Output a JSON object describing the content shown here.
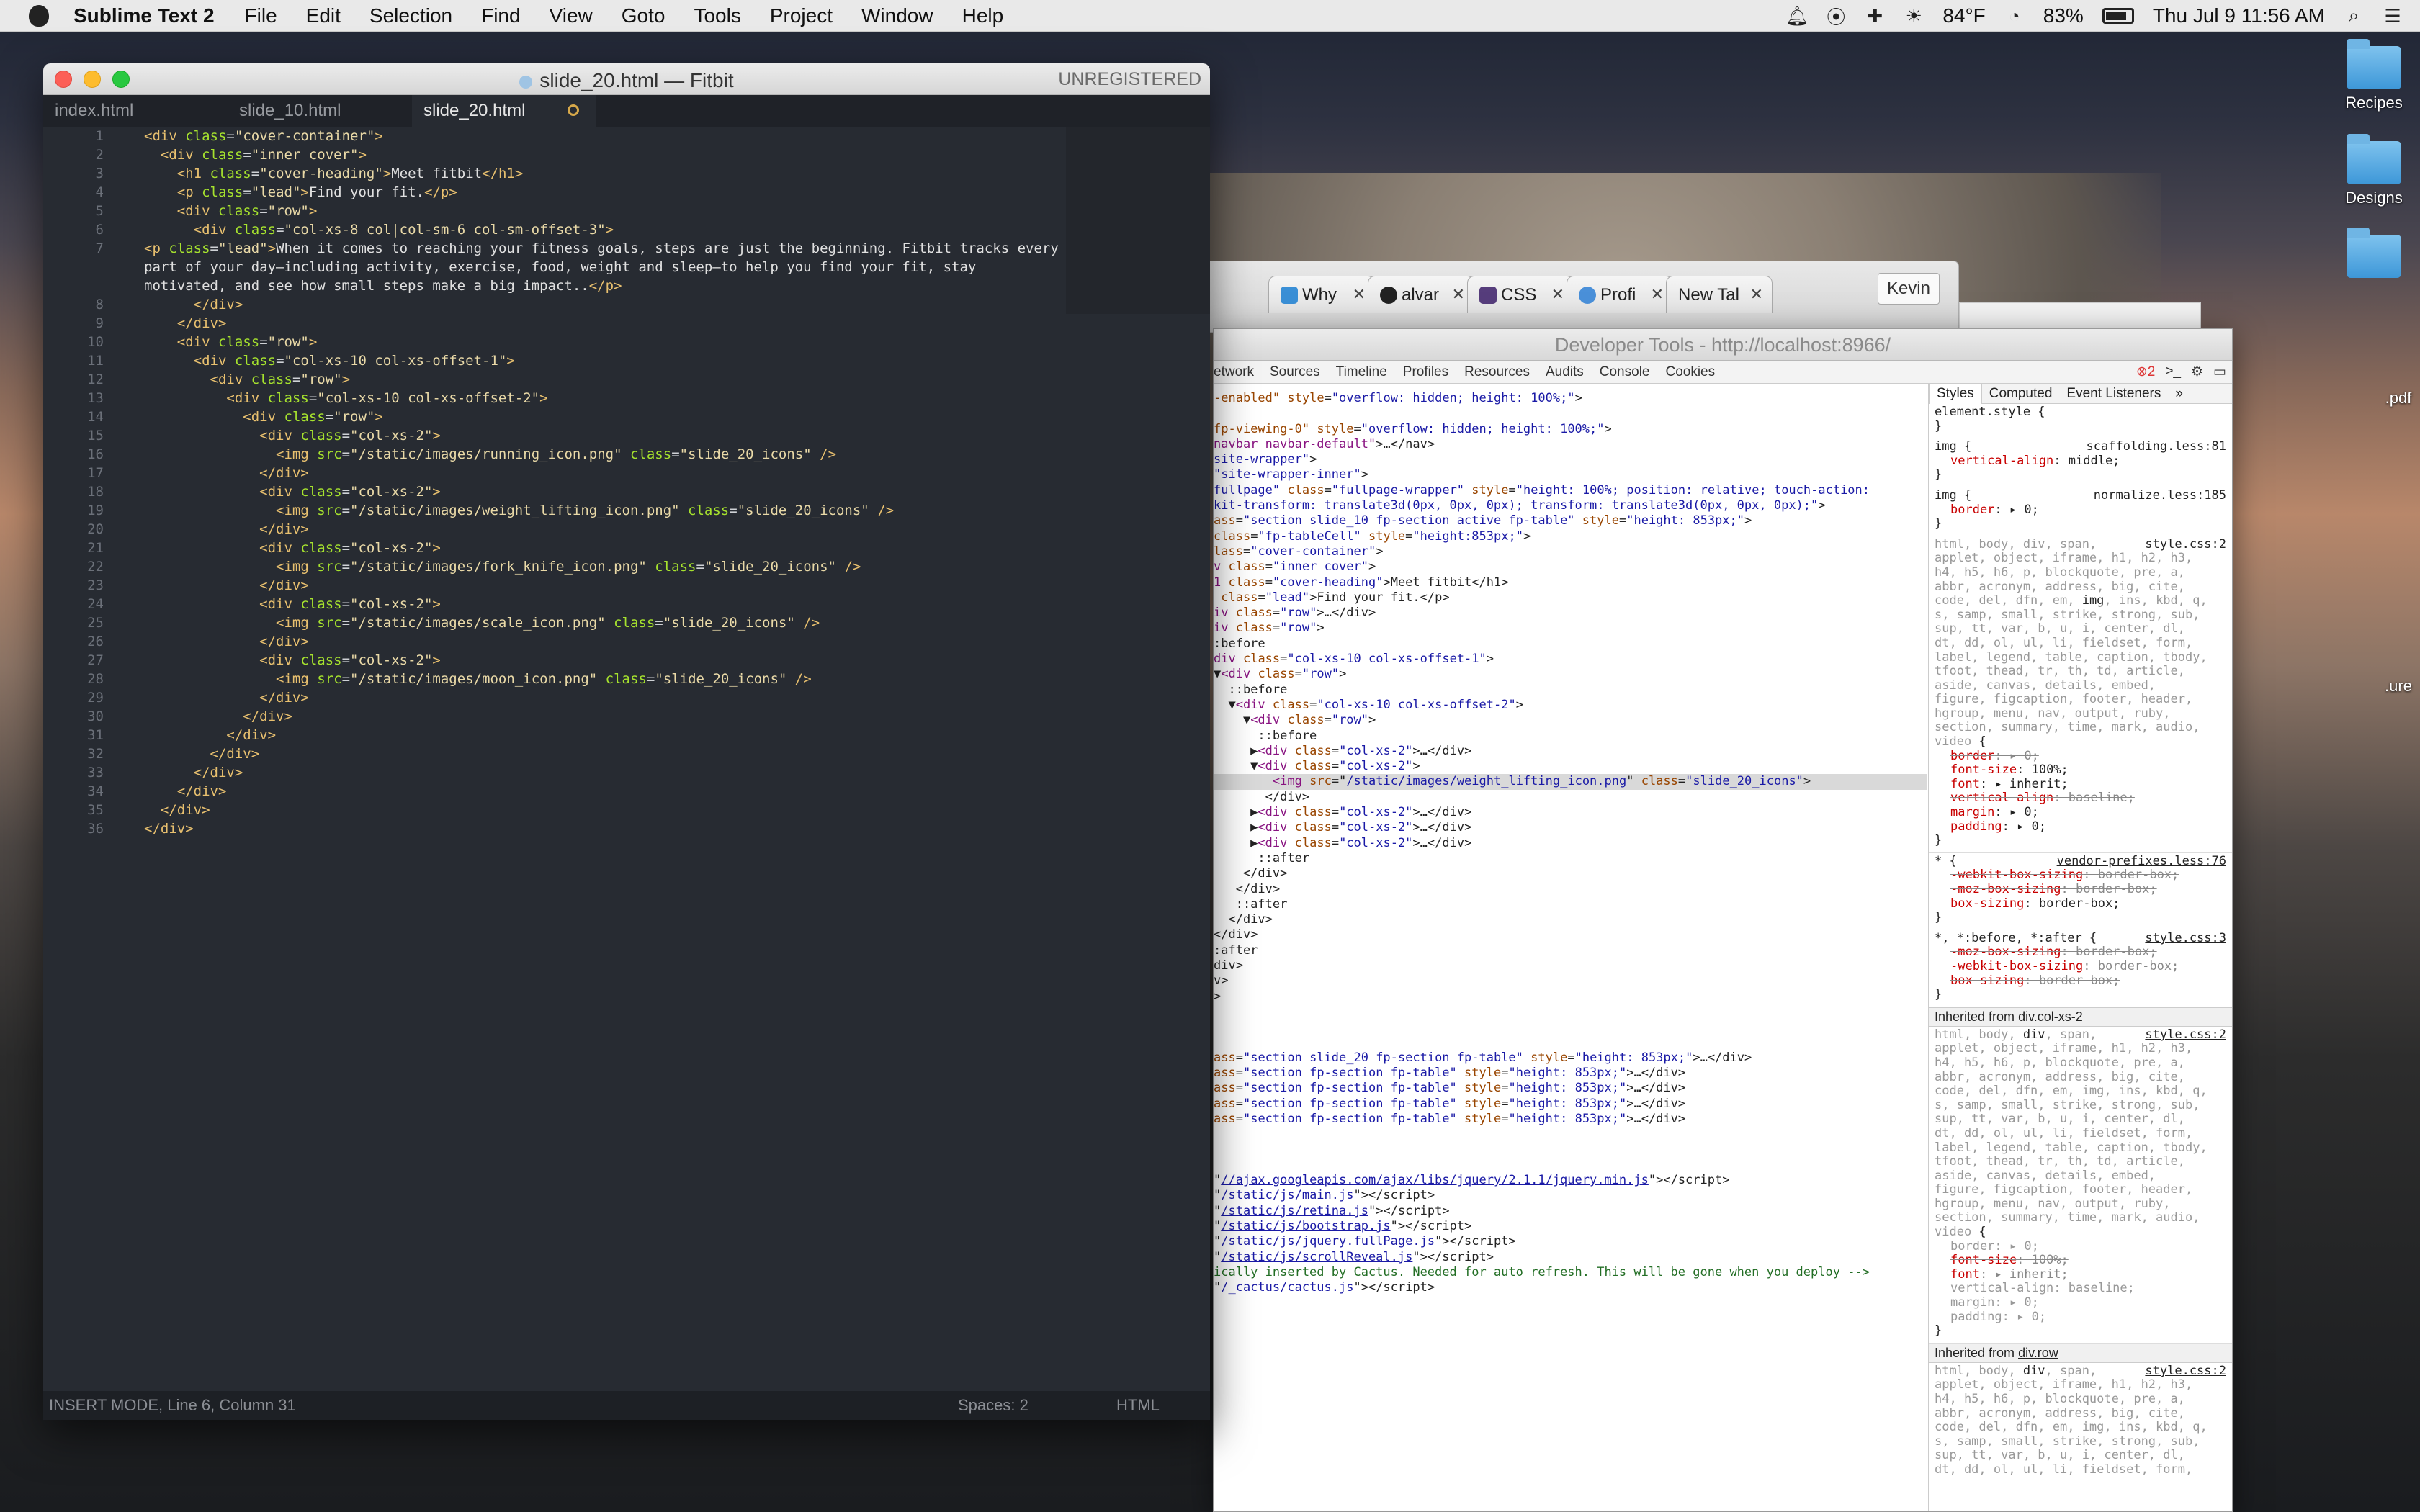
{
  "menubar": {
    "app_name": "Sublime Text 2",
    "items": [
      "File",
      "Edit",
      "Selection",
      "Find",
      "View",
      "Goto",
      "Tools",
      "Project",
      "Window",
      "Help"
    ],
    "status_icons": [
      "bell-icon",
      "sync-icon",
      "plus-cross-icon",
      "weather-icon",
      "wifi-icon",
      "battery-icon",
      "search-icon",
      "list-icon"
    ],
    "weather": "84°F",
    "battery": "83%",
    "clock": "Thu Jul 9  11:56 AM"
  },
  "desktop": {
    "icons": [
      {
        "label": "Recipes",
        "kind": "folder"
      },
      {
        "label": "Designs",
        "kind": "folder"
      },
      {
        "label": "",
        "kind": "folder"
      }
    ],
    "partial_labels": [
      ".pdf",
      ".ure"
    ]
  },
  "sublime": {
    "title": "slide_20.html — Fitbit",
    "unregistered": "UNREGISTERED",
    "tabs": [
      {
        "label": "index.html",
        "active": false
      },
      {
        "label": "slide_10.html",
        "active": false
      },
      {
        "label": "slide_20.html",
        "active": true
      }
    ],
    "status": {
      "mode": "INSERT MODE, Line 6, Column 31",
      "spaces": "Spaces: 2",
      "syntax": "HTML"
    },
    "code_lines": [
      {
        "n": "1",
        "html": "<span class=\"t\">&lt;div</span> <span class=\"a\">class</span>=<span class=\"s\">\"cover-container\"</span><span class=\"t\">&gt;</span>"
      },
      {
        "n": "2",
        "html": "  <span class=\"t\">&lt;div</span> <span class=\"a\">class</span>=<span class=\"s\">\"inner cover\"</span><span class=\"t\">&gt;</span>"
      },
      {
        "n": "3",
        "html": "    <span class=\"t\">&lt;h1</span> <span class=\"a\">class</span>=<span class=\"s\">\"cover-heading\"</span><span class=\"t\">&gt;</span><span class=\"tx\">Meet fitbit</span><span class=\"t\">&lt;/h1&gt;</span>"
      },
      {
        "n": "4",
        "html": "    <span class=\"t\">&lt;p</span> <span class=\"a\">class</span>=<span class=\"s\">\"lead\"</span><span class=\"t\">&gt;</span><span class=\"tx\">Find your fit.</span><span class=\"t\">&lt;/p&gt;</span>"
      },
      {
        "n": "5",
        "html": "    <span class=\"t\">&lt;div</span> <span class=\"a\">class</span>=<span class=\"s\">\"row\"</span><span class=\"t\">&gt;</span>"
      },
      {
        "n": "6",
        "html": "      <span class=\"t\">&lt;div</span> <span class=\"a\">class</span>=<span class=\"s\">\"col-xs-8 col|col-sm-6 col-sm-offset-3\"</span><span class=\"t\">&gt;</span>"
      },
      {
        "n": "7",
        "wrap": true,
        "html": "        <span class=\"t\">&lt;p</span> <span class=\"a\">class</span>=<span class=\"s\">\"lead\"</span><span class=\"t\">&gt;</span><span class=\"tx\">When it comes to reaching your fitness goals, steps are just the beginning. Fitbit tracks every part of your day—including activity, exercise, food, weight and sleep—to help you find your fit, stay motivated, and see how small steps make a big impact..</span><span class=\"t\">&lt;/p&gt;</span>"
      },
      {
        "n": "8",
        "html": "      <span class=\"t\">&lt;/div&gt;</span>"
      },
      {
        "n": "9",
        "html": "    <span class=\"t\">&lt;/div&gt;</span>"
      },
      {
        "n": "10",
        "html": "    <span class=\"t\">&lt;div</span> <span class=\"a\">class</span>=<span class=\"s\">\"row\"</span><span class=\"t\">&gt;</span>"
      },
      {
        "n": "11",
        "html": "      <span class=\"t\">&lt;div</span> <span class=\"a\">class</span>=<span class=\"s\">\"col-xs-10 col-xs-offset-1\"</span><span class=\"t\">&gt;</span>"
      },
      {
        "n": "12",
        "html": "        <span class=\"t\">&lt;div</span> <span class=\"a\">class</span>=<span class=\"s\">\"row\"</span><span class=\"t\">&gt;</span>"
      },
      {
        "n": "13",
        "html": "          <span class=\"t\">&lt;div</span> <span class=\"a\">class</span>=<span class=\"s\">\"col-xs-10 col-xs-offset-2\"</span><span class=\"t\">&gt;</span>"
      },
      {
        "n": "14",
        "html": "            <span class=\"t\">&lt;div</span> <span class=\"a\">class</span>=<span class=\"s\">\"row\"</span><span class=\"t\">&gt;</span>"
      },
      {
        "n": "15",
        "html": "              <span class=\"t\">&lt;div</span> <span class=\"a\">class</span>=<span class=\"s\">\"col-xs-2\"</span><span class=\"t\">&gt;</span>"
      },
      {
        "n": "16",
        "html": "                <span class=\"t\">&lt;img</span> <span class=\"a\">src</span>=<span class=\"s\">\"/static/images/running_icon.png\"</span> <span class=\"a\">class</span>=<span class=\"s\">\"slide_20_icons\"</span> <span class=\"t\">/&gt;</span>"
      },
      {
        "n": "17",
        "html": "              <span class=\"t\">&lt;/div&gt;</span>"
      },
      {
        "n": "18",
        "html": "              <span class=\"t\">&lt;div</span> <span class=\"a\">class</span>=<span class=\"s\">\"col-xs-2\"</span><span class=\"t\">&gt;</span>"
      },
      {
        "n": "19",
        "html": "                <span class=\"t\">&lt;img</span> <span class=\"a\">src</span>=<span class=\"s\">\"/static/images/weight_lifting_icon.png\"</span> <span class=\"a\">class</span>=<span class=\"s\">\"slide_20_icons\"</span> <span class=\"t\">/&gt;</span>"
      },
      {
        "n": "20",
        "html": "              <span class=\"t\">&lt;/div&gt;</span>"
      },
      {
        "n": "21",
        "html": "              <span class=\"t\">&lt;div</span> <span class=\"a\">class</span>=<span class=\"s\">\"col-xs-2\"</span><span class=\"t\">&gt;</span>"
      },
      {
        "n": "22",
        "html": "                <span class=\"t\">&lt;img</span> <span class=\"a\">src</span>=<span class=\"s\">\"/static/images/fork_knife_icon.png\"</span> <span class=\"a\">class</span>=<span class=\"s\">\"slide_20_icons\"</span> <span class=\"t\">/&gt;</span>"
      },
      {
        "n": "23",
        "html": "              <span class=\"t\">&lt;/div&gt;</span>"
      },
      {
        "n": "24",
        "html": "              <span class=\"t\">&lt;div</span> <span class=\"a\">class</span>=<span class=\"s\">\"col-xs-2\"</span><span class=\"t\">&gt;</span>"
      },
      {
        "n": "25",
        "html": "                <span class=\"t\">&lt;img</span> <span class=\"a\">src</span>=<span class=\"s\">\"/static/images/scale_icon.png\"</span> <span class=\"a\">class</span>=<span class=\"s\">\"slide_20_icons\"</span> <span class=\"t\">/&gt;</span>"
      },
      {
        "n": "26",
        "html": "              <span class=\"t\">&lt;/div&gt;</span>"
      },
      {
        "n": "27",
        "html": "              <span class=\"t\">&lt;div</span> <span class=\"a\">class</span>=<span class=\"s\">\"col-xs-2\"</span><span class=\"t\">&gt;</span>"
      },
      {
        "n": "28",
        "html": "                <span class=\"t\">&lt;img</span> <span class=\"a\">src</span>=<span class=\"s\">\"/static/images/moon_icon.png\"</span> <span class=\"a\">class</span>=<span class=\"s\">\"slide_20_icons\"</span> <span class=\"t\">/&gt;</span>"
      },
      {
        "n": "29",
        "html": "              <span class=\"t\">&lt;/div&gt;</span>"
      },
      {
        "n": "30",
        "html": "            <span class=\"t\">&lt;/div&gt;</span>"
      },
      {
        "n": "31",
        "html": "          <span class=\"t\">&lt;/div&gt;</span>"
      },
      {
        "n": "32",
        "html": "        <span class=\"t\">&lt;/div&gt;</span>"
      },
      {
        "n": "33",
        "html": "      <span class=\"t\">&lt;/div&gt;</span>"
      },
      {
        "n": "34",
        "html": "    <span class=\"t\">&lt;/div&gt;</span>"
      },
      {
        "n": "35",
        "html": "  <span class=\"t\">&lt;/div&gt;</span>"
      },
      {
        "n": "36",
        "html": "<span class=\"t\">&lt;/div&gt;</span>"
      }
    ]
  },
  "browser": {
    "tabs": [
      "Why",
      "alvar",
      "CSS",
      "Profi",
      "New Tal"
    ],
    "profile": "Kevin"
  },
  "devtools": {
    "title": "Developer Tools - http://localhost:8966/",
    "panels": [
      "etwork",
      "Sources",
      "Timeline",
      "Profiles",
      "Resources",
      "Audits",
      "Console",
      "Cookies"
    ],
    "error_count": "2",
    "sidebar_tabs": [
      "Styles",
      "Computed",
      "Event Listeners",
      "»"
    ],
    "element_lines": [
      "<span class=\"an\">-enabled\"</span> <span class=\"an\">style</span>=<span class=\"av\">\"overflow: hidden; height: 100%;\"</span>&gt;",
      "",
      "<span class=\"an\">fp-viewing-0\"</span> <span class=\"an\">style</span>=<span class=\"av\">\"overflow: hidden; height: 100%;\"</span>&gt;",
      "<span class=\"tn\">navbar navbar-default\"</span>&gt;…&lt;/nav&gt;",
      "<span class=\"av\">site-wrapper\"</span>&gt;",
      "<span class=\"av\">\"site-wrapper-inner\"</span>&gt;",
      "<span class=\"av\">fullpage\"</span> <span class=\"an\">class</span>=<span class=\"av\">\"fullpage-wrapper\"</span> <span class=\"an\">style</span>=<span class=\"av\">\"height: 100%; position: relative; touch-action:</span>",
      "<span class=\"av\">kit-transform: translate3d(0px, 0px, 0px); transform: translate3d(0px, 0px, 0px);\"</span>&gt;",
      "<span class=\"an\">ass</span>=<span class=\"av\">\"section slide_10 fp-section active fp-table\"</span> <span class=\"an\">style</span>=<span class=\"av\">\"height: 853px;\"</span>&gt;",
      "<span class=\"an\">class</span>=<span class=\"av\">\"fp-tableCell\"</span> <span class=\"an\">style</span>=<span class=\"av\">\"height:853px;\"</span>&gt;",
      "<span class=\"an\">lass</span>=<span class=\"av\">\"cover-container\"</span>&gt;",
      "<span class=\"tn\">v</span> <span class=\"an\">class</span>=<span class=\"av\">\"inner cover\"</span>&gt;",
      "<span class=\"tn\">1</span> <span class=\"an\">class</span>=<span class=\"av\">\"cover-heading\"</span>&gt;Meet fitbit&lt;/h1&gt;",
      " <span class=\"an\">class</span>=<span class=\"av\">\"lead\"</span>&gt;Find your fit.&lt;/p&gt;",
      "<span class=\"tn\">iv</span> <span class=\"an\">class</span>=<span class=\"av\">\"row\"</span>&gt;…&lt;/div&gt;",
      "<span class=\"tn\">iv</span> <span class=\"an\">class</span>=<span class=\"av\">\"row\"</span>&gt;",
      ":before",
      "<span class=\"tn\">div</span> <span class=\"an\">class</span>=<span class=\"av\">\"col-xs-10 col-xs-offset-1\"</span>&gt;",
      "▼<span class=\"tn\">&lt;div</span> <span class=\"an\">class</span>=<span class=\"av\">\"row\"</span>&gt;",
      "  ::before",
      "  ▼<span class=\"tn\">&lt;div</span> <span class=\"an\">class</span>=<span class=\"av\">\"col-xs-10 col-xs-offset-2\"</span>&gt;",
      "    ▼<span class=\"tn\">&lt;div</span> <span class=\"an\">class</span>=<span class=\"av\">\"row\"</span>&gt;",
      "      ::before",
      "     ▶<span class=\"tn\">&lt;div</span> <span class=\"an\">class</span>=<span class=\"av\">\"col-xs-2\"</span>&gt;…&lt;/div&gt;",
      "     ▼<span class=\"tn\">&lt;div</span> <span class=\"an\">class</span>=<span class=\"av\">\"col-xs-2\"</span>&gt;",
      "        <span class=\"tn\">&lt;img</span> <span class=\"an\">src</span>=\"<span class=\"lk\">/static/images/weight_lifting_icon.png</span>\" <span class=\"an\">class</span>=<span class=\"av\">\"slide_20_icons\"</span>&gt;",
      "       &lt;/div&gt;",
      "     ▶<span class=\"tn\">&lt;div</span> <span class=\"an\">class</span>=<span class=\"av\">\"col-xs-2\"</span>&gt;…&lt;/div&gt;",
      "     ▶<span class=\"tn\">&lt;div</span> <span class=\"an\">class</span>=<span class=\"av\">\"col-xs-2\"</span>&gt;…&lt;/div&gt;",
      "     ▶<span class=\"tn\">&lt;div</span> <span class=\"an\">class</span>=<span class=\"av\">\"col-xs-2\"</span>&gt;…&lt;/div&gt;",
      "      ::after",
      "    &lt;/div&gt;",
      "   &lt;/div&gt;",
      "   ::after",
      "  &lt;/div&gt;",
      "&lt;/div&gt;",
      ":after",
      "div&gt;",
      "v&gt;",
      "&gt;",
      "",
      "",
      "",
      "<span class=\"an\">ass</span>=<span class=\"av\">\"section slide_20 fp-section fp-table\"</span> <span class=\"an\">style</span>=<span class=\"av\">\"height: 853px;\"</span>&gt;…&lt;/div&gt;",
      "<span class=\"an\">ass</span>=<span class=\"av\">\"section fp-section fp-table\"</span> <span class=\"an\">style</span>=<span class=\"av\">\"height: 853px;\"</span>&gt;…&lt;/div&gt;",
      "<span class=\"an\">ass</span>=<span class=\"av\">\"section fp-section fp-table\"</span> <span class=\"an\">style</span>=<span class=\"av\">\"height: 853px;\"</span>&gt;…&lt;/div&gt;",
      "<span class=\"an\">ass</span>=<span class=\"av\">\"section fp-section fp-table\"</span> <span class=\"an\">style</span>=<span class=\"av\">\"height: 853px;\"</span>&gt;…&lt;/div&gt;",
      "<span class=\"an\">ass</span>=<span class=\"av\">\"section fp-section fp-table\"</span> <span class=\"an\">style</span>=<span class=\"av\">\"height: 853px;\"</span>&gt;…&lt;/div&gt;",
      "",
      "",
      "",
      "\"<span class=\"lk\">//ajax.googleapis.com/ajax/libs/jquery/2.1.1/jquery.min.js</span>\"&gt;&lt;/script&gt;",
      "\"<span class=\"lk\">/static/js/main.js</span>\"&gt;&lt;/script&gt;",
      "\"<span class=\"lk\">/static/js/retina.js</span>\"&gt;&lt;/script&gt;",
      "\"<span class=\"lk\">/static/js/bootstrap.js</span>\"&gt;&lt;/script&gt;",
      "\"<span class=\"lk\">/static/js/jquery.fullPage.js</span>\"&gt;&lt;/script&gt;",
      "\"<span class=\"lk\">/static/js/scrollReveal.js</span>\"&gt;&lt;/script&gt;",
      "<span class=\"cm\">ically inserted by Cactus. Needed for auto refresh. This will be gone when you deploy --&gt;</span>",
      "\"<span class=\"lk\">/_cactus/cactus.js</span>\"&gt;&lt;/script&gt;"
    ],
    "selected_element_index": 25,
    "styles": [
      {
        "kind": "rule",
        "html": "element.style {<br>}"
      },
      {
        "kind": "rule",
        "src": "scaffolding.less:81",
        "html": "img {<div class=\"p\"><span class=\"pn\">vertical-align</span>: middle;</div>}"
      },
      {
        "kind": "rule",
        "src": "normalize.less:185",
        "html": "img {<div class=\"p\"><span class=\"pn\">border</span>: ▸ 0;</div>}"
      },
      {
        "kind": "rule",
        "src": "style.css:2",
        "html": "<span class=\"gray\">html, body, div, span,<br>applet, object, iframe, h1, h2, h3,<br>h4, h5, h6, p, blockquote, pre, a,<br>abbr, acronym, address, big, cite,<br>code, del, dfn, em, </span>img<span class=\"gray\">, ins, kbd, q,<br>s, samp, small, strike, strong, sub,<br>sup, tt, var, b, u, i, center, dl,<br>dt, dd, ol, ul, li, fieldset, form,<br>label, legend, table, caption, tbody,<br>tfoot, thead, tr, th, td, article,<br>aside, canvas, details, embed,<br>figure, figcaption, footer, header,<br>hgroup, menu, nav, output, ruby,<br>section, summary, time, mark, audio,<br>video</span> {<div class=\"p strike\"><span class=\"pn\">border</span>: ▸ 0;</div><div class=\"p\"><span class=\"pn\">font-size</span>: 100%;</div><div class=\"p\"><span class=\"pn\">font</span>: ▸ inherit;</div><div class=\"p strike\"><span class=\"pn\">vertical-align</span>: baseline;</div><div class=\"p\"><span class=\"pn\">margin</span>: ▸ 0;</div><div class=\"p\"><span class=\"pn\">padding</span>: ▸ 0;</div>}"
      },
      {
        "kind": "rule",
        "src": "vendor-prefixes.less:76",
        "html": "* {<div class=\"p strike\"><span class=\"pn\">-webkit-box-sizing</span>: border-box;</div><div class=\"p strike\"><span class=\"pn\">-moz-box-sizing</span>: border-box;</div><div class=\"p\"><span class=\"pn\">box-sizing</span>: border-box;</div>}"
      },
      {
        "kind": "rule",
        "src": "style.css:3",
        "html": "*, *:before, *:after {<div class=\"p strike\"><span class=\"pn\">-moz-box-sizing</span>: border-box;</div><div class=\"p strike\"><span class=\"pn\">-webkit-box-sizing</span>: border-box;</div><div class=\"p strike\"><span class=\"pn\">box-sizing</span>: border-box;</div>}"
      },
      {
        "kind": "inherited",
        "html": "Inherited from <u>div.col-xs-2</u>"
      },
      {
        "kind": "rule",
        "src": "style.css:2",
        "html": "<span class=\"gray\">html, body, </span>div<span class=\"gray\">, span,<br>applet, object, iframe, h1, h2, h3,<br>h4, h5, h6, p, blockquote, pre, a,<br>abbr, acronym, address, big, cite,<br>code, del, dfn, em, img, ins, kbd, q,<br>s, samp, small, strike, strong, sub,<br>sup, tt, var, b, u, i, center, dl,<br>dt, dd, ol, ul, li, fieldset, form,<br>label, legend, table, caption, tbody,<br>tfoot, thead, tr, th, td, article,<br>aside, canvas, details, embed,<br>figure, figcaption, footer, header,<br>hgroup, menu, nav, output, ruby,<br>section, summary, time, mark, audio,<br>video</span> {<div class=\"p gray\">border: ▸ 0;</div><div class=\"p strike\"><span class=\"pn\">font-size</span>: 100%;</div><div class=\"p strike\"><span class=\"pn\">font</span>: ▸ inherit;</div><div class=\"p gray\">vertical-align: baseline;</div><div class=\"p gray\">margin: ▸ 0;</div><div class=\"p gray\">padding: ▸ 0;</div>}"
      },
      {
        "kind": "inherited",
        "html": "Inherited from <u>div.row</u>"
      },
      {
        "kind": "rule",
        "src": "style.css:2",
        "html": "<span class=\"gray\">html, body, </span>div<span class=\"gray\">, span,<br>applet, object, iframe, h1, h2, h3,<br>h4, h5, h6, p, blockquote, pre, a,<br>abbr, acronym, address, big, cite,<br>code, del, dfn, em, img, ins, kbd, q,<br>s, samp, small, strike, strong, sub,<br>sup, tt, var, b, u, i, center, dl,<br>dt, dd, ol, ul, li, fieldset, form,</span>"
      }
    ]
  }
}
